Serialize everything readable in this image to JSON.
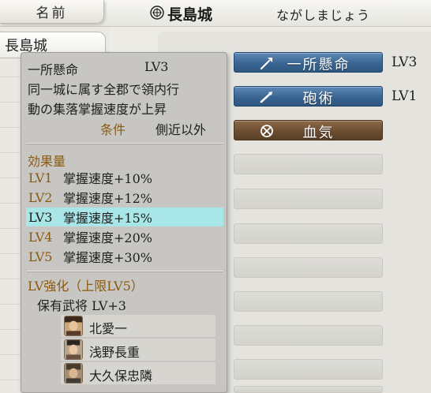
{
  "header": {
    "name_tab_label": "名前",
    "castle_name": "長島城",
    "castle_reading": "ながしまじょう"
  },
  "left_list": {
    "selected_castle": "長島城"
  },
  "skill_slots": [
    {
      "label": "一所懸命",
      "level": "LV3",
      "style": "blue",
      "icon": "spear-icon"
    },
    {
      "label": "砲術",
      "level": "LV1",
      "style": "blue",
      "icon": "gun-icon"
    },
    {
      "label": "血気",
      "level": "",
      "style": "brown",
      "icon": "crossed-circle-icon"
    }
  ],
  "empty_slot_count": 8,
  "tooltip": {
    "skill_name": "一所懸命",
    "skill_level": "LV3",
    "description_line1": "同一城に属す全郡で領内行",
    "description_line2": "動の集落掌握速度が上昇",
    "condition_label": "条件",
    "condition_value": "側近以外",
    "effect_heading": "効果量",
    "levels": [
      {
        "lv": "LV1",
        "effect": "掌握速度+10%",
        "current": false
      },
      {
        "lv": "LV2",
        "effect": "掌握速度+12%",
        "current": false
      },
      {
        "lv": "LV3",
        "effect": "掌握速度+15%",
        "current": true
      },
      {
        "lv": "LV4",
        "effect": "掌握速度+20%",
        "current": false
      },
      {
        "lv": "LV5",
        "effect": "掌握速度+30%",
        "current": false
      }
    ],
    "enhance_heading": "LV強化（上限LV5）",
    "enhance_detail": "保有武将 LV+3",
    "generals": [
      {
        "name": "北愛一"
      },
      {
        "name": "浅野長重"
      },
      {
        "name": "大久保忠隣"
      }
    ]
  },
  "colors": {
    "highlight": "#a8e6e8",
    "gold_text": "#8a5a10",
    "blue_slot": "#3a6592",
    "brown_slot": "#6a4b30"
  }
}
